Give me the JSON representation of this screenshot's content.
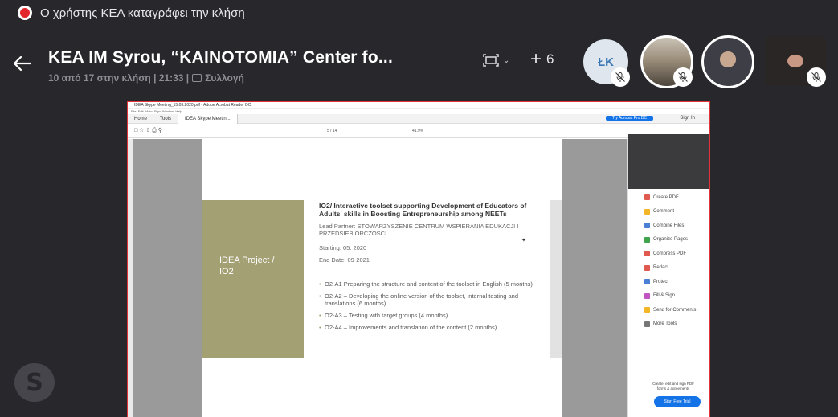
{
  "recording": {
    "text": "Ο χρήστης ΚΕΑ καταγράφει την κλήση"
  },
  "header": {
    "title": "KEA IM Syrou, “KAINOTOMIA” Center fo...",
    "subtitle_left": "10 από 17 στην κλήση | 21:33 |",
    "subtitle_right": "Συλλογή",
    "participants_extra": "6"
  },
  "participants": [
    {
      "initials": "ŁK",
      "muted": true
    },
    {
      "initials": "",
      "muted": true
    },
    {
      "initials": "",
      "muted": false
    },
    {
      "initials": "",
      "muted": true
    }
  ],
  "shared_screen": {
    "window_title": "IDEA Skype Meeting_15.03.2020.pdf - Adobe Acrobat Reader DC",
    "menu": [
      "File",
      "Edit",
      "View",
      "Sign",
      "Window",
      "Help"
    ],
    "tabs": [
      "Home",
      "Tools",
      "IDEA Skype Meetin..."
    ],
    "try_button": "Try Acrobat Pro DC",
    "sign_in": "Sign In",
    "page_indicator": "5 / 14",
    "zoom": "41.9%",
    "slide": {
      "box_title": "IDEA Project / IO2",
      "heading": "IO2/ Interactive toolset supporting Development of Educators of Adults' skills in Boosting Entrepreneurship among NEETs",
      "lead_partner": "Lead Partner: STOWARZYSZENIE CENTRUM WSPIERANIA EDUKACJI I PRZEDSIEBIORCZOSCI",
      "starting": "Starting: 05. 2020",
      "end_date": "End Date: 09-2021",
      "bullets": [
        "O2-A1 Preparing the structure and content of the toolset in English (5 months)",
        "O2-A2 – Developing the online version of the toolset, internal testing and translations (6 months)",
        "O2-A3 – Testing with target groups (4 months)",
        "O2-A4 – Improvements and translation of the content (2 months)"
      ]
    },
    "tools_panel": {
      "items": [
        {
          "label": "Create PDF",
          "color": "#e05a4f"
        },
        {
          "label": "Comment",
          "color": "#f3b627"
        },
        {
          "label": "Combine Files",
          "color": "#4a7fd6"
        },
        {
          "label": "Organize Pages",
          "color": "#3fa34d"
        },
        {
          "label": "Compress PDF",
          "color": "#e05a4f"
        },
        {
          "label": "Redact",
          "color": "#e05a4f"
        },
        {
          "label": "Protect",
          "color": "#4a7fd6"
        },
        {
          "label": "Fill & Sign",
          "color": "#c255c2"
        },
        {
          "label": "Send for Comments",
          "color": "#f3b627"
        },
        {
          "label": "More Tools",
          "color": "#777777"
        }
      ],
      "note": "Create, edit and sign PDF forms & agreements",
      "button": "Start Free Trial"
    }
  }
}
